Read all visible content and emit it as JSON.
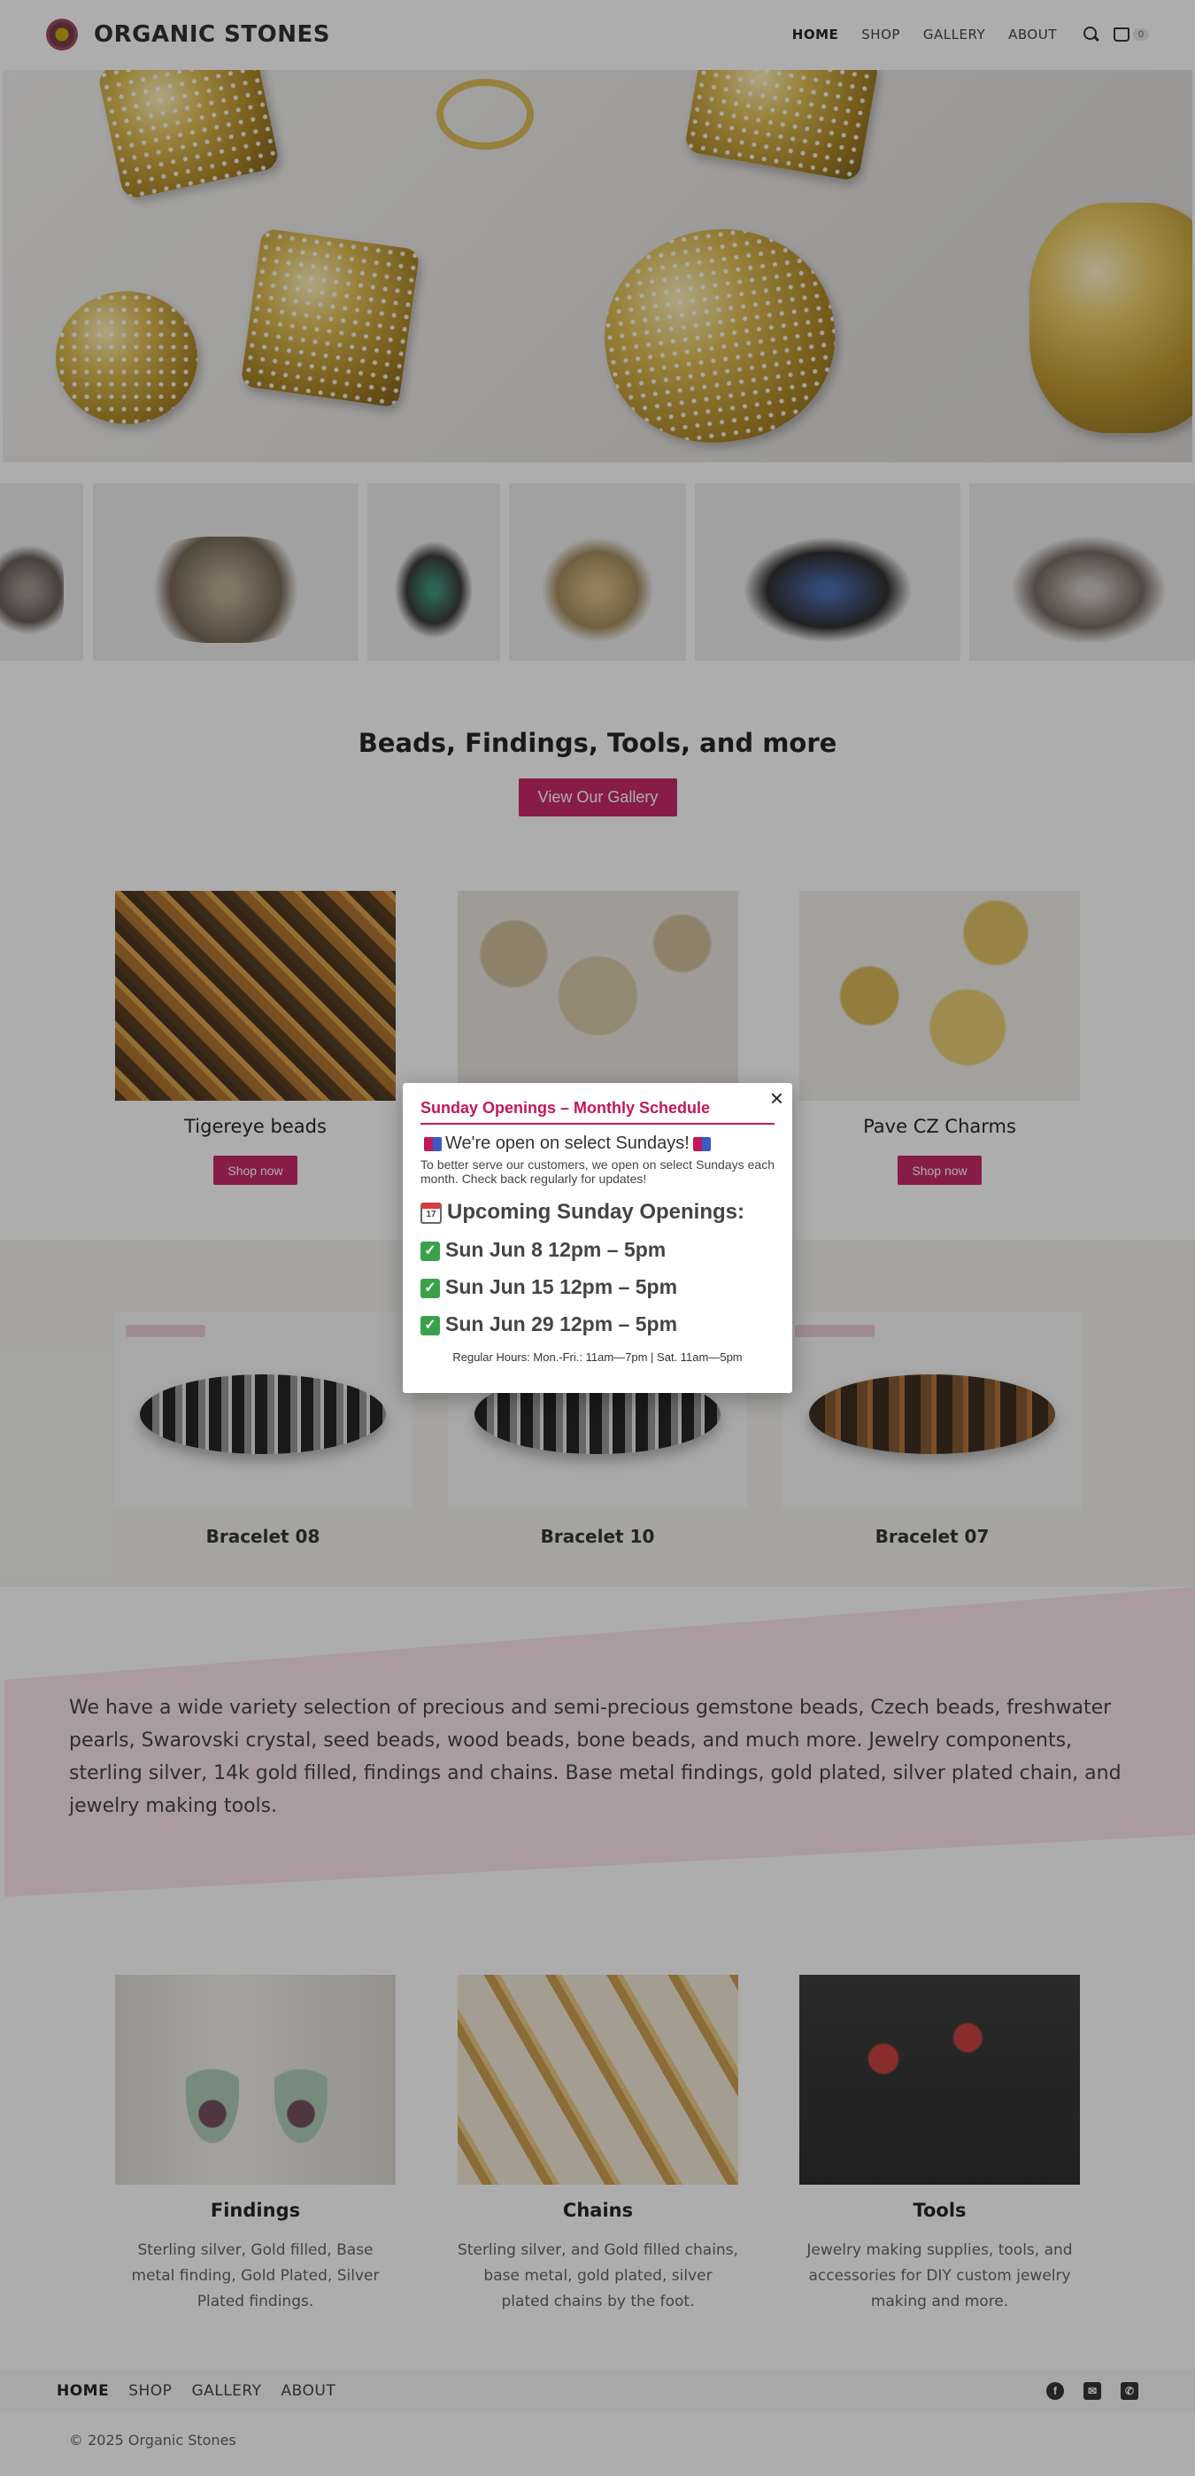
{
  "header": {
    "brand": "ORGANIC STONES",
    "nav": [
      {
        "label": "HOME",
        "active": true
      },
      {
        "label": "SHOP"
      },
      {
        "label": "GALLERY"
      },
      {
        "label": "ABOUT"
      }
    ],
    "cart_count": "0"
  },
  "main": {
    "headline": "Beads, Findings, Tools, and more",
    "gallery_button": "View Our Gallery",
    "feature_cards": [
      {
        "title": "Tigereye beads",
        "button": "Shop now"
      },
      {
        "title": "",
        "button": ""
      },
      {
        "title": "Pave CZ Charms",
        "button": "Shop now"
      }
    ],
    "products": [
      {
        "title": "Bracelet 08"
      },
      {
        "title": "Bracelet 10"
      },
      {
        "title": "Bracelet 07"
      }
    ],
    "description": "We have a wide variety selection of precious and semi-precious gemstone beads, Czech beads, freshwater pearls, Swarovski crystal, seed beads, wood beads, bone beads, and much more. Jewelry components, sterling silver, 14k gold filled, findings and chains. Base metal findings, gold plated, silver plated chain, and jewelry making tools.",
    "categories": [
      {
        "title": "Findings",
        "text": "Sterling silver, Gold filled, Base metal finding, Gold Plated, Silver Plated findings."
      },
      {
        "title": "Chains",
        "text": "Sterling silver, and Gold filled chains, base metal, gold plated, silver plated chains by the foot."
      },
      {
        "title": "Tools",
        "text": "Jewelry making supplies, tools, and accessories for DIY custom jewelry making and more."
      }
    ]
  },
  "footer": {
    "nav": [
      {
        "label": "HOME",
        "active": true
      },
      {
        "label": "SHOP"
      },
      {
        "label": "GALLERY"
      },
      {
        "label": "ABOUT"
      }
    ],
    "social": [
      "facebook-icon",
      "email-icon",
      "phone-icon"
    ],
    "copyright": "© 2025 Organic Stones"
  },
  "modal": {
    "title": "Sunday Openings – Monthly Schedule",
    "open_text": "We're open on select Sundays!",
    "note": "To better serve our customers, we open on select Sundays each month. Check back regularly for updates!",
    "upcoming_label": "Upcoming Sunday Openings:",
    "dates": [
      "Sun Jun 8 12pm – 5pm",
      "Sun Jun 15 12pm – 5pm",
      "Sun Jun 29 12pm – 5pm"
    ],
    "regular_hours": "Regular Hours: Mon.-Fri.: 11am—7pm | Sat. 11am—5pm",
    "close": "×",
    "calendar_glyph": "17",
    "check_glyph": "✓"
  },
  "colors": {
    "accent": "#c2185b",
    "band": "#f2f1ec",
    "pink_block": "#fbe3ea"
  }
}
